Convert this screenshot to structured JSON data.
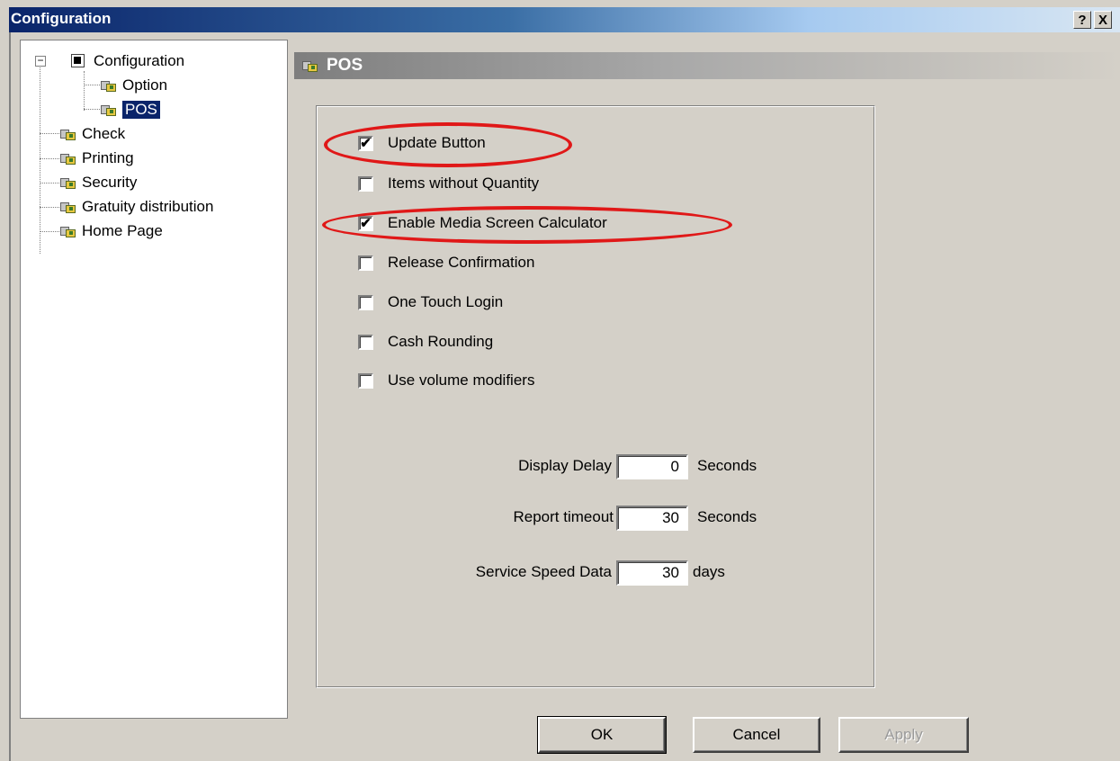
{
  "window": {
    "title": "Configuration",
    "help_label": "?",
    "close_label": "X"
  },
  "tree": {
    "items": [
      {
        "label": "Configuration",
        "icon": "tree-root-icon",
        "expander": "−"
      },
      {
        "label": "Option",
        "icon": "settings-icon"
      },
      {
        "label": "POS",
        "icon": "settings-icon",
        "selected": true
      },
      {
        "label": "Check",
        "icon": "settings-icon"
      },
      {
        "label": "Printing",
        "icon": "settings-icon"
      },
      {
        "label": "Security",
        "icon": "settings-icon"
      },
      {
        "label": "Gratuity distribution",
        "icon": "settings-icon"
      },
      {
        "label": "Home Page",
        "icon": "settings-icon"
      }
    ]
  },
  "panel": {
    "title": "POS",
    "checkboxes": [
      {
        "label": "Update Button",
        "checked": true,
        "mark": "✔"
      },
      {
        "label": "Items without Quantity",
        "checked": false,
        "mark": ""
      },
      {
        "label": "Enable Media Screen Calculator",
        "checked": true,
        "mark": "✔"
      },
      {
        "label": "Release Confirmation",
        "checked": false,
        "mark": ""
      },
      {
        "label": "One Touch Login",
        "checked": false,
        "mark": ""
      },
      {
        "label": "Cash Rounding",
        "checked": false,
        "mark": ""
      },
      {
        "label": "Use volume modifiers",
        "checked": false,
        "mark": ""
      }
    ],
    "fields": [
      {
        "label": "Display Delay",
        "value": "0",
        "unit": "Seconds"
      },
      {
        "label": "Report timeout",
        "value": "30",
        "unit": "Seconds"
      },
      {
        "label": "Service Speed Data",
        "value": "30",
        "unit": "days"
      }
    ]
  },
  "buttons": {
    "ok": "OK",
    "cancel": "Cancel",
    "apply": "Apply"
  },
  "colors": {
    "annotation": "#e01818",
    "selection": "#0a246a",
    "title_bar": "#0a246a"
  }
}
